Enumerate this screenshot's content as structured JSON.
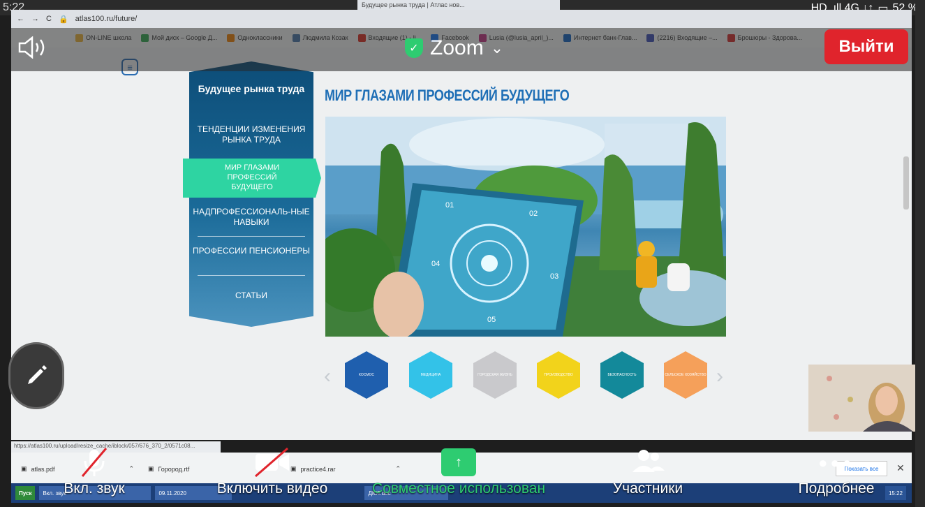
{
  "status": {
    "time": "5:22",
    "network": "HD .ıll 4G ↓↑",
    "battery": "52 %"
  },
  "browser": {
    "tab_label": "Будущее рынка труда | Атлас нов...",
    "url": "atlas100.ru/future/"
  },
  "bookmarks": [
    {
      "label": "ON-LINE школа",
      "color": "#e8b23a"
    },
    {
      "label": "Мой диск – Google Д...",
      "color": "#34a853"
    },
    {
      "label": "Одноклассники",
      "color": "#ee8208"
    },
    {
      "label": "Людмила Козак",
      "color": "#4a76a8"
    },
    {
      "label": "Входящие (1) - li...",
      "color": "#d93025"
    },
    {
      "label": "Facebook",
      "color": "#1877f2"
    },
    {
      "label": "Lusia (@lusia_april_)...",
      "color": "#c13584"
    },
    {
      "label": "Интернет банк-Глав...",
      "color": "#1565c0"
    },
    {
      "label": "(2216) Входящие –...",
      "color": "#3f51b5"
    },
    {
      "label": "Брошюры - Здорова...",
      "color": "#d32f2f"
    }
  ],
  "zoom": {
    "title": "Zoom",
    "exit": "Выйти"
  },
  "site": {
    "nav_heading": "Будущее рынка труда",
    "nav_items": [
      "ТЕНДЕНЦИИ ИЗМЕНЕНИЯ РЫНКА ТРУДА",
      "МИР ГЛАЗАМИ ПРОФЕССИЙ БУДУЩЕГО",
      "НАДПРОФЕССИОНАЛЬ-НЫЕ НАВЫКИ",
      "ПРОФЕССИИ ПЕНСИОНЕРЫ",
      "СТАТЬИ"
    ],
    "page_title": "МИР ГЛАЗАМИ ПРОФЕССИЙ БУДУЩЕГО",
    "tablet_labels": [
      "01",
      "02",
      "03",
      "04",
      "05"
    ],
    "hexes": [
      {
        "label": "КОСМОС",
        "color": "#1f5fae"
      },
      {
        "label": "МЕДИЦИНА",
        "color": "#33c2e8"
      },
      {
        "label": "ГОРОДСКАЯ ЖИЗНЬ",
        "color": "#c9c9cc"
      },
      {
        "label": "ПРОИЗВОДСТВО",
        "color": "#f2d31b"
      },
      {
        "label": "БЕЗОПАСНОСТЬ",
        "color": "#13899a"
      },
      {
        "label": "СЕЛЬСКОЕ ХОЗЯЙСТВО",
        "color": "#f5a05a"
      }
    ]
  },
  "link_url": "https://atlas100.ru/upload/resize_cache/iblock/057/676_370_2/0571c08...",
  "downloads": [
    {
      "name": "atlas.pdf"
    },
    {
      "name": "Горород.rtf"
    },
    {
      "name": "practice4.rar"
    }
  ],
  "show_all": "Показать все",
  "taskbar": [
    "Пуск",
    "Вкл. звук",
    "09.11.2020",
    "ДЮТ.doc",
    "15:22"
  ],
  "toolbar": {
    "mute": "Вкл. звук",
    "video": "Включить видео",
    "share": "Совместное использован",
    "participants": "Участники",
    "more": "Подробнее"
  },
  "colors": {
    "exit": "#e0242c",
    "share": "#2ecc71",
    "nav_active": "#2ed4a2",
    "title": "#1f6fb6"
  }
}
